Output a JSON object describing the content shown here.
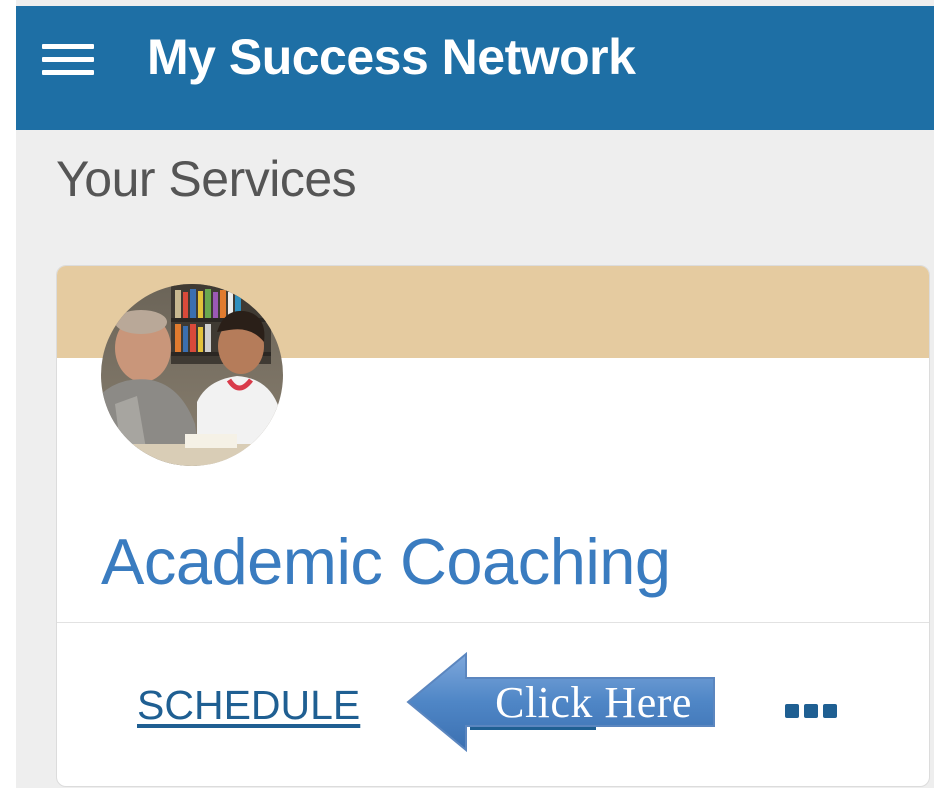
{
  "header": {
    "title": "My Success Network",
    "menu_icon": "hamburger-menu-icon",
    "background": "#1e6fa5"
  },
  "section": {
    "title": "Your Services"
  },
  "service_card": {
    "banner_color": "#e5cba0",
    "title": "Academic Coaching",
    "title_color": "#3a7cc0",
    "actions": {
      "schedule_label": "SCHEDULE",
      "more_icon": "more-options-icon"
    }
  },
  "annotation": {
    "callout_text": "Click Here",
    "arrow_color": "#4f86c6"
  }
}
